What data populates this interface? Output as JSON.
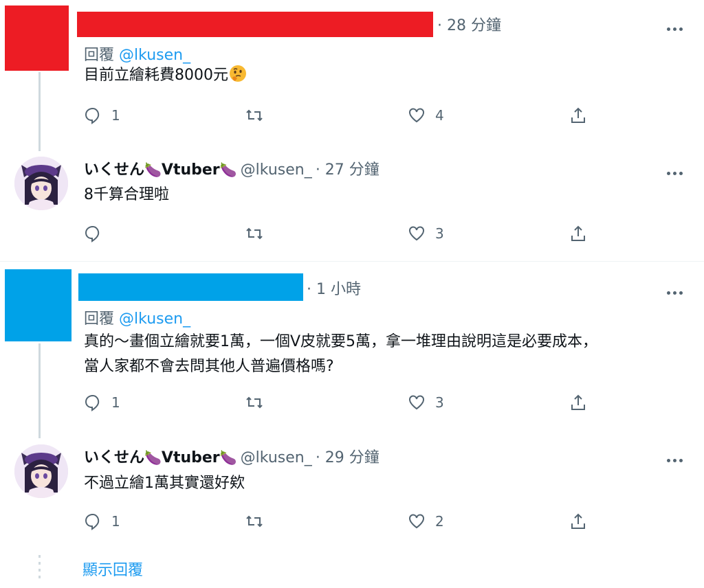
{
  "tweets": [
    {
      "time": "· 28 分鐘",
      "reply_label": "回覆",
      "reply_mention": "@lkusen_",
      "text": "目前立繪耗費8000元",
      "emoji": "thinking-face",
      "replies": "1",
      "retweets": "",
      "likes": "4"
    },
    {
      "display_name_1": "いくせん",
      "display_name_2": "Vtuber",
      "handle": "@lkusen_",
      "time": "· 27 分鐘",
      "text": "8千算合理啦",
      "replies": "",
      "retweets": "",
      "likes": "3"
    },
    {
      "time": "· 1 小時",
      "reply_label": "回覆",
      "reply_mention": "@lkusen_",
      "text_line1": "真的～畫個立繪就要1萬，一個V皮就要5萬，拿一堆理由說明這是必要成本，",
      "text_line2": "當人家都不會去問其他人普遍價格嗎?",
      "replies": "1",
      "retweets": "",
      "likes": "3"
    },
    {
      "display_name_1": "いくせん",
      "display_name_2": "Vtuber",
      "handle": "@lkusen_",
      "time": "· 29 分鐘",
      "text": "不過立繪1萬其實還好欸",
      "replies": "1",
      "retweets": "",
      "likes": "2"
    }
  ],
  "show_replies": "顯示回覆",
  "colors": {
    "redact_red": "#ed1c24",
    "redact_blue": "#00a2e8",
    "link": "#1d9bf0",
    "muted": "#536471"
  }
}
